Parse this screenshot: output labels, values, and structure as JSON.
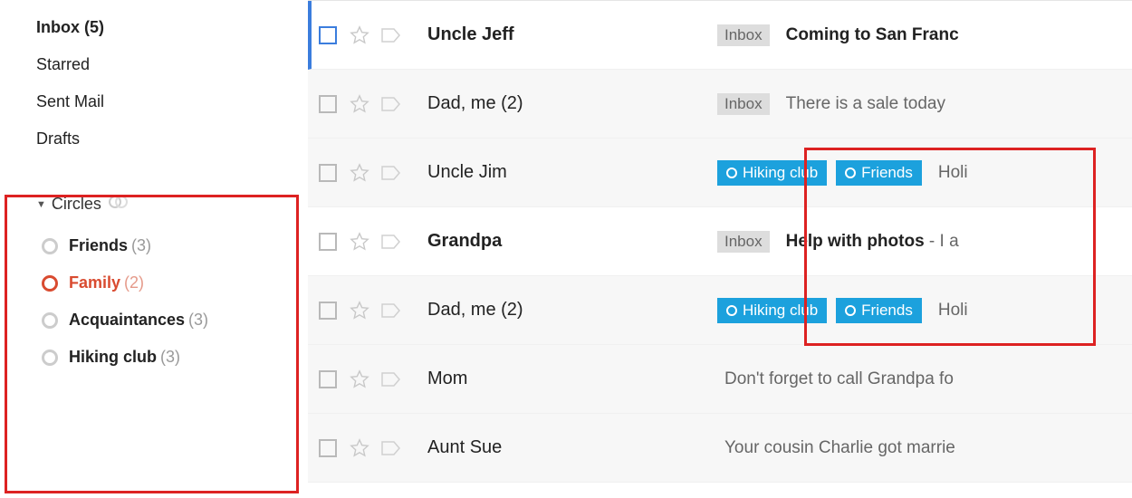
{
  "sidebar": {
    "inbox": "Inbox (5)",
    "starred": "Starred",
    "sentmail": "Sent Mail",
    "drafts": "Drafts"
  },
  "circles": {
    "header": "Circles",
    "items": [
      {
        "name": "Friends",
        "count": "(3)",
        "selected": false
      },
      {
        "name": "Family",
        "count": "(2)",
        "selected": true
      },
      {
        "name": "Acquaintances",
        "count": "(3)",
        "selected": false
      },
      {
        "name": "Hiking club",
        "count": "(3)",
        "selected": false
      }
    ]
  },
  "labelsText": {
    "inbox": "Inbox"
  },
  "circleLabels": {
    "hiking": "Hiking club",
    "friends": "Friends"
  },
  "rows": {
    "r0": {
      "sender": "Uncle Jeff",
      "title": "Coming to San Franc",
      "snippet": ""
    },
    "r1": {
      "sender": "Dad, me (2)",
      "title": "",
      "snippet": "There is a sale today "
    },
    "r2": {
      "sender": "Uncle Jim",
      "title": "",
      "snippet": "Holi"
    },
    "r3": {
      "sender": "Grandpa",
      "title": "Help with photos",
      "snippet": " - I a"
    },
    "r4": {
      "sender": "Dad, me (2)",
      "title": "",
      "snippet": "Holi"
    },
    "r5": {
      "sender": "Mom",
      "title": "",
      "snippet": "Don't forget to call Grandpa fo"
    },
    "r6": {
      "sender": "Aunt Sue",
      "title": "",
      "snippet": "Your cousin Charlie got marrie"
    }
  },
  "colors": {
    "highlight": "#d22",
    "circleLabel": "#1ca1dd",
    "selectedBar": "#3b7ddd",
    "familySelected": "#d94b30"
  }
}
